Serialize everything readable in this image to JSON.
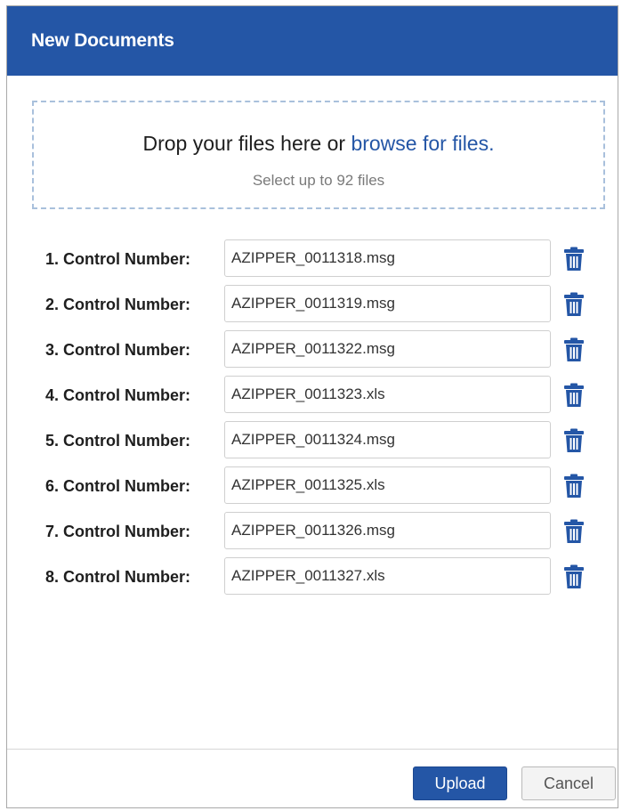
{
  "dialog": {
    "title": "New Documents",
    "accent_color": "#2456a6"
  },
  "dropzone": {
    "prompt": "Drop your files here or ",
    "link": "browse for files.",
    "hint": "Select up to 92 files"
  },
  "rows": [
    {
      "label": "1. Control Number:",
      "value": "AZIPPER_0011318.msg",
      "icon": "trash-icon"
    },
    {
      "label": "2. Control Number:",
      "value": "AZIPPER_0011319.msg",
      "icon": "trash-icon"
    },
    {
      "label": "3. Control Number:",
      "value": "AZIPPER_0011322.msg",
      "icon": "trash-icon"
    },
    {
      "label": "4. Control Number:",
      "value": "AZIPPER_0011323.xls",
      "icon": "trash-icon"
    },
    {
      "label": "5. Control Number:",
      "value": "AZIPPER_0011324.msg",
      "icon": "trash-icon"
    },
    {
      "label": "6. Control Number:",
      "value": "AZIPPER_0011325.xls",
      "icon": "trash-icon"
    },
    {
      "label": "7. Control Number:",
      "value": "AZIPPER_0011326.msg",
      "icon": "trash-icon"
    },
    {
      "label": "8. Control Number:",
      "value": "AZIPPER_0011327.xls",
      "icon": "trash-icon"
    }
  ],
  "footer": {
    "upload_label": "Upload",
    "cancel_label": "Cancel"
  }
}
